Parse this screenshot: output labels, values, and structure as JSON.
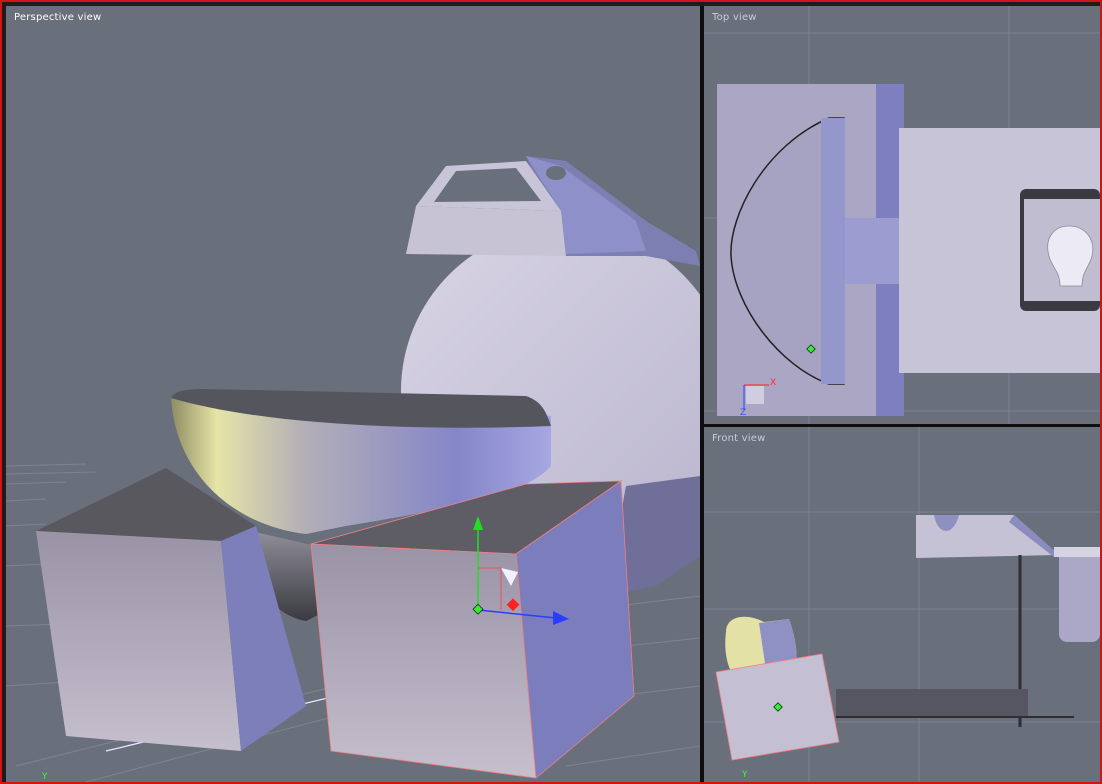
{
  "viewports": {
    "perspective": {
      "label": "Perspective view",
      "axis_y": "Y"
    },
    "top": {
      "label": "Top view",
      "axis_x": "X",
      "axis_z": "Z"
    },
    "front": {
      "label": "Front view",
      "axis_y": "Y"
    }
  },
  "colors": {
    "viewport_bg": "#6a6f7c",
    "active_border": "#d21414",
    "grid": "#7d8290",
    "object_light": "#c8c4d6",
    "object_shadow": "#7c7fb8",
    "highlight_yellow": "#e7e5a8",
    "gizmo_x": "#ff2020",
    "gizmo_y": "#22dd22",
    "gizmo_z": "#2a3cff"
  }
}
